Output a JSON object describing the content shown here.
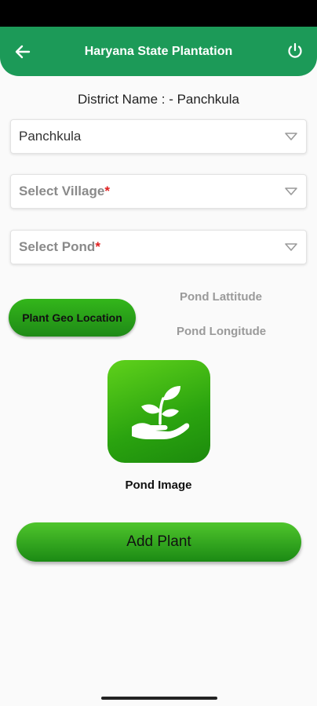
{
  "app_bar": {
    "title": "Haryana State Plantation",
    "back_icon": "arrow-left-icon",
    "power_icon": "power-icon"
  },
  "district": {
    "label": "District Name : - Panchkula"
  },
  "dropdowns": {
    "district": {
      "value": "Panchkula"
    },
    "village": {
      "placeholder": "Select Village",
      "required_mark": "*"
    },
    "pond": {
      "placeholder": "Select Pond",
      "required_mark": "*"
    }
  },
  "geo": {
    "button_label": "Plant Geo Location",
    "latitude_label": "Pond Lattitude",
    "longitude_label": "Pond Longitude"
  },
  "pond_image": {
    "icon": "plant-in-hand-icon",
    "label": "Pond Image"
  },
  "add_button": {
    "label": "Add Plant"
  },
  "colors": {
    "primary": "#1c9a58",
    "button_green": "#2aa30f",
    "required": "#e02020"
  }
}
